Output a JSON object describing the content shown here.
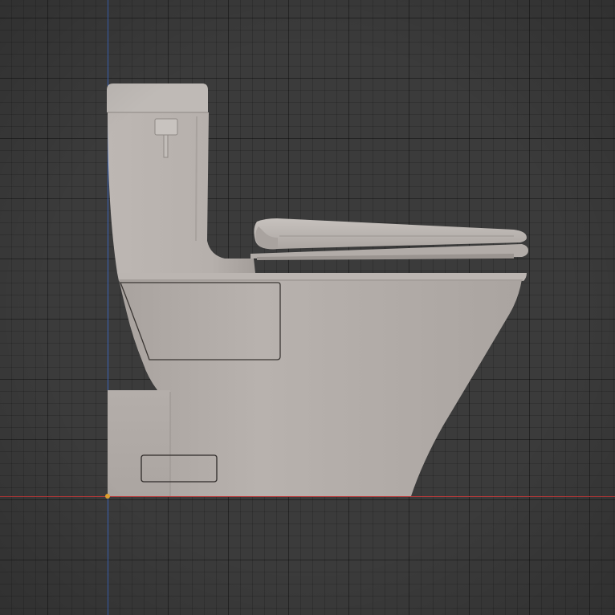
{
  "viewport": {
    "background": "#3b3b3b",
    "grid_color": "#2c2c2c",
    "axis_x_color": "#b83a3a",
    "axis_y_color": "#3b63b5",
    "origin_color": "#e0a030"
  },
  "model": {
    "object": "toilet-one-piece",
    "view": "side",
    "material_color": "#b5afab",
    "shadow_color": "#8d8783",
    "highlight_color": "#cdc8c4"
  }
}
